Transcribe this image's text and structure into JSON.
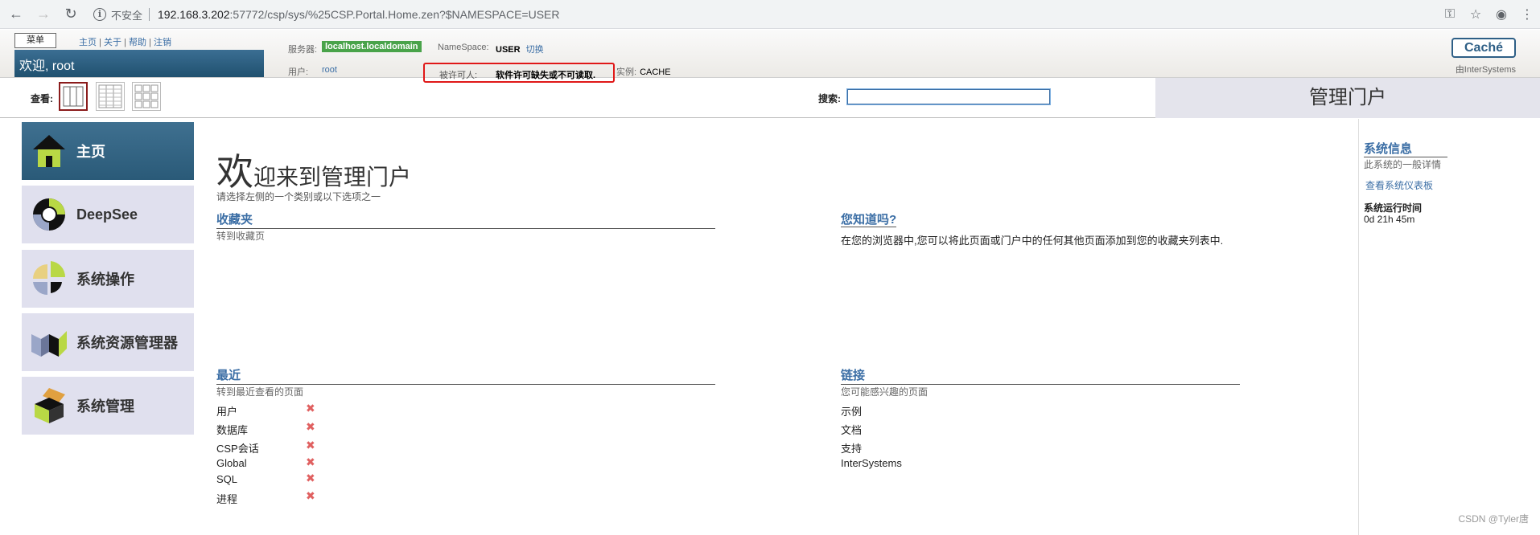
{
  "browser": {
    "insecure_label": "不安全",
    "url_host": "192.168.3.202",
    "url_rest": ":57772/csp/sys/%25CSP.Portal.Home.zen?$NAMESPACE=USER"
  },
  "header": {
    "menu_label": "菜单",
    "links": [
      "主页",
      "关于",
      "帮助",
      "注销"
    ],
    "welcome": "欢迎, root",
    "server_label": "服务器:",
    "server_value": "localhost.localdomain",
    "namespace_label": "NameSpace:",
    "namespace_value": "USER",
    "switch_label": "切换",
    "user_label": "用户:",
    "user_value": "root",
    "licensee_label": "被许可人:",
    "licensee_value": "软件许可缺失或不可读取.",
    "instance_label": "实例:",
    "instance_value": "CACHE",
    "cache_button": "Caché",
    "by_intersystems": "由InterSystems"
  },
  "viewrow": {
    "view_label": "查看:",
    "search_label": "搜索:",
    "search_value": "",
    "portal_title": "管理门户"
  },
  "nav": [
    {
      "label": "主页",
      "icon": "home-icon"
    },
    {
      "label": "DeepSee",
      "icon": "deepsee-icon"
    },
    {
      "label": "系统操作",
      "icon": "pie-chart-icon"
    },
    {
      "label": "系统资源管理器",
      "icon": "explorer-icon"
    },
    {
      "label": "系统管理",
      "icon": "admin-box-icon"
    }
  ],
  "main": {
    "welcome_big": "欢",
    "welcome_rest": "迎来到管理门户",
    "subtitle": "请选择左侧的一个类别或以下选项之一",
    "favorites_title": "收藏夹",
    "favorites_sub": "转到收藏页",
    "didyouknow_title": "您知道吗?",
    "didyouknow_text": "在您的浏览器中,您可以将此页面或门户中的任何其他页面添加到您的收藏夹列表中.",
    "recent_title": "最近",
    "recent_sub": "转到最近查看的页面",
    "recent_items": [
      "用户",
      "数据库",
      "CSP会话",
      "Global",
      "SQL",
      "进程"
    ],
    "links_title": "链接",
    "links_sub": "您可能感兴趣的页面",
    "links_items": [
      "示例",
      "文档",
      "支持",
      "InterSystems"
    ]
  },
  "sidebar_right": {
    "title": "系统信息",
    "sub": "此系统的一般详情",
    "dashboard_link": "查看系统仪表板",
    "uptime_label": "系统运行时间",
    "uptime_value": "0d 21h 45m"
  },
  "watermark": "CSDN @Tyler唐"
}
